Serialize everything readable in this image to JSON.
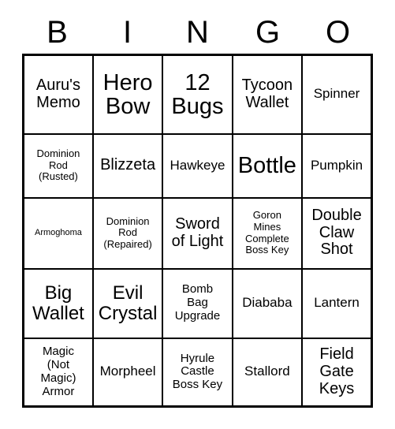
{
  "card": {
    "headers": [
      "B",
      "I",
      "N",
      "G",
      "O"
    ],
    "rows": [
      [
        {
          "label": "Auru's\nMemo",
          "size": "lg"
        },
        {
          "label": "Hero\nBow",
          "size": "xxl"
        },
        {
          "label": "12\nBugs",
          "size": "xxl"
        },
        {
          "label": "Tycoon\nWallet",
          "size": "lg"
        },
        {
          "label": "Spinner",
          "size": "md"
        }
      ],
      [
        {
          "label": "Dominion\nRod\n(Rusted)",
          "size": "xs"
        },
        {
          "label": "Blizzeta",
          "size": "lg"
        },
        {
          "label": "Hawkeye",
          "size": "md"
        },
        {
          "label": "Bottle",
          "size": "xxl"
        },
        {
          "label": "Pumpkin",
          "size": "md"
        }
      ],
      [
        {
          "label": "Armoghoma",
          "size": "xxs"
        },
        {
          "label": "Dominion\nRod\n(Repaired)",
          "size": "xs"
        },
        {
          "label": "Sword\nof Light",
          "size": "lg"
        },
        {
          "label": "Goron\nMines\nComplete\nBoss Key",
          "size": "xs"
        },
        {
          "label": "Double\nClaw\nShot",
          "size": "lg"
        }
      ],
      [
        {
          "label": "Big\nWallet",
          "size": "xl"
        },
        {
          "label": "Evil\nCrystal",
          "size": "xl"
        },
        {
          "label": "Bomb\nBag\nUpgrade",
          "size": "sm"
        },
        {
          "label": "Diababa",
          "size": "md"
        },
        {
          "label": "Lantern",
          "size": "md"
        }
      ],
      [
        {
          "label": "Magic\n(Not\nMagic)\nArmor",
          "size": "sm"
        },
        {
          "label": "Morpheel",
          "size": "md"
        },
        {
          "label": "Hyrule\nCastle\nBoss Key",
          "size": "sm"
        },
        {
          "label": "Stallord",
          "size": "md"
        },
        {
          "label": "Field\nGate\nKeys",
          "size": "lg"
        }
      ]
    ]
  }
}
